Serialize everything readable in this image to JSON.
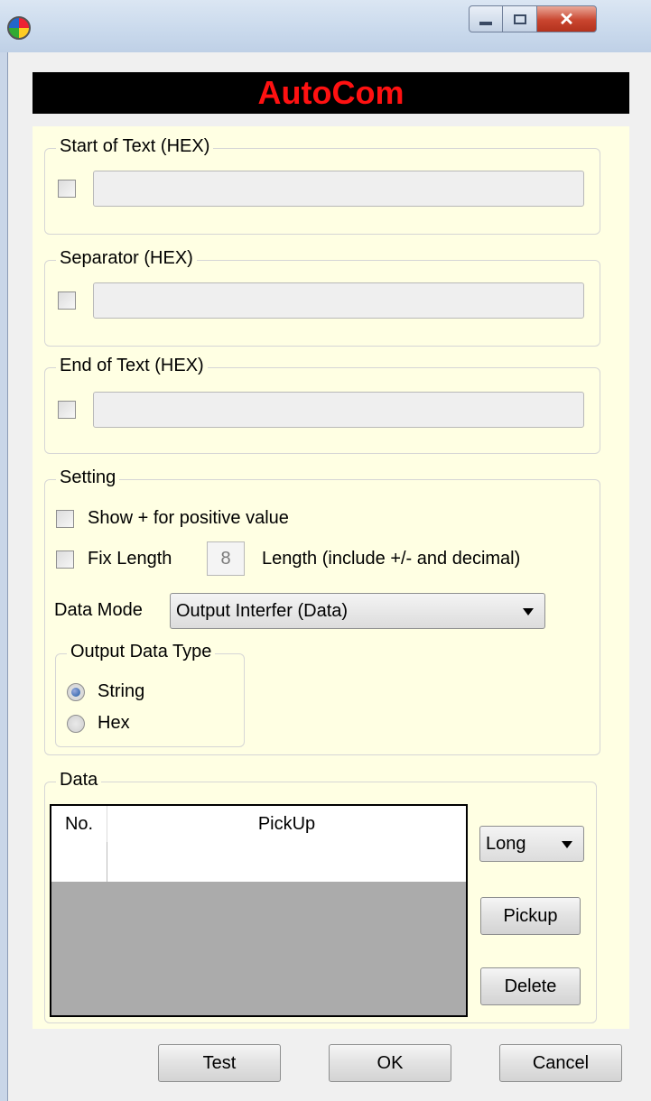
{
  "banner": {
    "title": "AutoCom"
  },
  "colors": {
    "banner_bg": "#000000",
    "banner_text": "#ff1111",
    "panel_bg": "#ffffe3"
  },
  "start_of_text": {
    "title": "Start of Text (HEX)",
    "checked": false,
    "value": ""
  },
  "separator": {
    "title": "Separator (HEX)",
    "checked": false,
    "value": ""
  },
  "end_of_text": {
    "title": "End of Text (HEX)",
    "checked": false,
    "value": ""
  },
  "setting": {
    "title": "Setting",
    "show_plus_label": "Show + for positive value",
    "fix_length_label": "Fix Length",
    "fix_length_value": "8",
    "length_hint": "Length (include +/- and decimal)",
    "data_mode_label": "Data Mode",
    "data_mode_value": "Output Interfer (Data)",
    "output_type": {
      "title": "Output Data Type",
      "options": [
        "String",
        "Hex"
      ],
      "selected": "String"
    }
  },
  "data": {
    "title": "Data",
    "columns": [
      "No.",
      "PickUp"
    ],
    "type_value": "Long",
    "pickup_button": "Pickup",
    "delete_button": "Delete"
  },
  "footer": {
    "test_button": "Test",
    "ok_button": "OK",
    "cancel_button": "Cancel"
  }
}
